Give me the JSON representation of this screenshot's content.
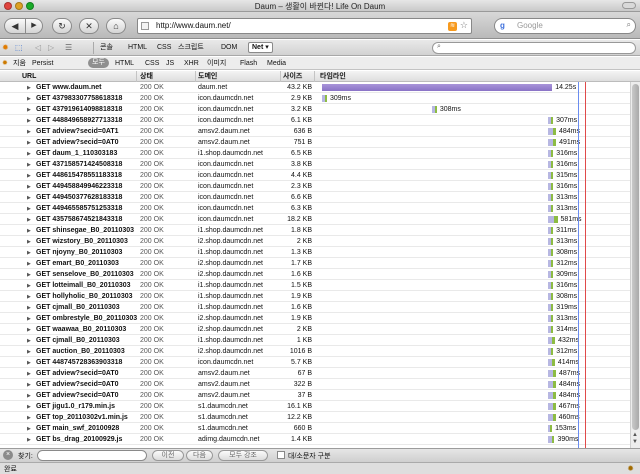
{
  "window": {
    "title": "Daum – 생활이 바뀐다! Life On Daum"
  },
  "nav": {
    "back_icon": "◀",
    "forward_icon": "▶",
    "reload_icon": "↻",
    "stop_icon": "✕",
    "home_icon": "⌂",
    "url": "http://www.daum.net/",
    "rss_icon": "rss",
    "bookmark_icon": "☆",
    "search_engine_icon": "g",
    "search_placeholder": "Google"
  },
  "firebug": {
    "tabs": [
      "콘솔",
      "HTML",
      "CSS",
      "스크립트",
      "DOM",
      "Net ▾"
    ],
    "active_tab": "Net"
  },
  "filters": {
    "clear": "지움",
    "persist": "Persist",
    "items": [
      "모두",
      "HTML",
      "CSS",
      "JS",
      "XHR",
      "이미지",
      "Flash",
      "Media"
    ],
    "active": "모두"
  },
  "columns": {
    "url": "URL",
    "status": "상태",
    "domain": "도메인",
    "size": "사이즈",
    "timeline": "타임라인"
  },
  "requests": [
    {
      "url": "GET www.daum.net",
      "status": "200 OK",
      "domain": "daum.net",
      "size": "43.2 KB",
      "time": "14.25s",
      "start": 0.0,
      "duration": 14.25
    },
    {
      "url": "GET 437983307758618318",
      "status": "200 OK",
      "domain": "icon.daumcdn.net",
      "size": "2.9 KB",
      "time": "309ms",
      "start": 0.0,
      "duration": 0.309
    },
    {
      "url": "GET 437919614098818318",
      "status": "200 OK",
      "domain": "icon.daumcdn.net",
      "size": "3.2 KB",
      "time": "308ms",
      "start": 6.8,
      "duration": 0.308
    },
    {
      "url": "GET 448849658927713318",
      "status": "200 OK",
      "domain": "icon.daumcdn.net",
      "size": "6.1 KB",
      "time": "307ms",
      "start": 14.0,
      "duration": 0.307
    },
    {
      "url": "GET adview?secid=0AT1",
      "status": "200 OK",
      "domain": "amsv2.daum.net",
      "size": "636 B",
      "time": "484ms",
      "start": 14.0,
      "duration": 0.484
    },
    {
      "url": "GET adview?secid=0AT0",
      "status": "200 OK",
      "domain": "amsv2.daum.net",
      "size": "751 B",
      "time": "491ms",
      "start": 14.0,
      "duration": 0.491
    },
    {
      "url": "GET daum_1_110303183",
      "status": "200 OK",
      "domain": "i1.shop.daumcdn.net",
      "size": "6.5 KB",
      "time": "316ms",
      "start": 14.0,
      "duration": 0.316
    },
    {
      "url": "GET 437158571424508318",
      "status": "200 OK",
      "domain": "icon.daumcdn.net",
      "size": "3.8 KB",
      "time": "316ms",
      "start": 14.0,
      "duration": 0.316
    },
    {
      "url": "GET 448615478551183318",
      "status": "200 OK",
      "domain": "icon.daumcdn.net",
      "size": "4.4 KB",
      "time": "315ms",
      "start": 14.0,
      "duration": 0.315
    },
    {
      "url": "GET 449458849946223318",
      "status": "200 OK",
      "domain": "icon.daumcdn.net",
      "size": "2.3 KB",
      "time": "316ms",
      "start": 14.0,
      "duration": 0.316
    },
    {
      "url": "GET 449450377628183318",
      "status": "200 OK",
      "domain": "icon.daumcdn.net",
      "size": "6.6 KB",
      "time": "313ms",
      "start": 14.0,
      "duration": 0.313
    },
    {
      "url": "GET 449465585751253318",
      "status": "200 OK",
      "domain": "icon.daumcdn.net",
      "size": "6.3 KB",
      "time": "313ms",
      "start": 14.0,
      "duration": 0.313
    },
    {
      "url": "GET 435758674521843318",
      "status": "200 OK",
      "domain": "icon.daumcdn.net",
      "size": "18.2 KB",
      "time": "581ms",
      "start": 14.0,
      "duration": 0.581
    },
    {
      "url": "GET shinsegae_B0_20110303",
      "status": "200 OK",
      "domain": "i1.shop.daumcdn.net",
      "size": "1.8 KB",
      "time": "311ms",
      "start": 14.0,
      "duration": 0.311
    },
    {
      "url": "GET wizstory_B0_20110303",
      "status": "200 OK",
      "domain": "i2.shop.daumcdn.net",
      "size": "2 KB",
      "time": "313ms",
      "start": 14.0,
      "duration": 0.313
    },
    {
      "url": "GET njoyny_B0_20110303",
      "status": "200 OK",
      "domain": "i1.shop.daumcdn.net",
      "size": "1.3 KB",
      "time": "308ms",
      "start": 14.0,
      "duration": 0.308
    },
    {
      "url": "GET emart_B0_20110303",
      "status": "200 OK",
      "domain": "i2.shop.daumcdn.net",
      "size": "1.7 KB",
      "time": "312ms",
      "start": 14.0,
      "duration": 0.312
    },
    {
      "url": "GET senselove_B0_20110303",
      "status": "200 OK",
      "domain": "i2.shop.daumcdn.net",
      "size": "1.6 KB",
      "time": "309ms",
      "start": 14.0,
      "duration": 0.309
    },
    {
      "url": "GET lotteimall_B0_20110303",
      "status": "200 OK",
      "domain": "i1.shop.daumcdn.net",
      "size": "1.5 KB",
      "time": "316ms",
      "start": 14.0,
      "duration": 0.316
    },
    {
      "url": "GET hollyholic_B0_20110303",
      "status": "200 OK",
      "domain": "i1.shop.daumcdn.net",
      "size": "1.9 KB",
      "time": "308ms",
      "start": 14.0,
      "duration": 0.308
    },
    {
      "url": "GET cjmall_B0_20110303",
      "status": "200 OK",
      "domain": "i1.shop.daumcdn.net",
      "size": "1.6 KB",
      "time": "319ms",
      "start": 14.0,
      "duration": 0.319
    },
    {
      "url": "GET ombrestyle_B0_20110303",
      "status": "200 OK",
      "domain": "i2.shop.daumcdn.net",
      "size": "1.9 KB",
      "time": "313ms",
      "start": 14.0,
      "duration": 0.313
    },
    {
      "url": "GET waawaa_B0_20110303",
      "status": "200 OK",
      "domain": "i2.shop.daumcdn.net",
      "size": "2 KB",
      "time": "314ms",
      "start": 14.0,
      "duration": 0.314
    },
    {
      "url": "GET cjmall_B0_20110303",
      "status": "200 OK",
      "domain": "i1.shop.daumcdn.net",
      "size": "1 KB",
      "time": "432ms",
      "start": 14.0,
      "duration": 0.432
    },
    {
      "url": "GET auction_B0_20110303",
      "status": "200 OK",
      "domain": "i2.shop.daumcdn.net",
      "size": "1016 B",
      "time": "312ms",
      "start": 14.0,
      "duration": 0.312
    },
    {
      "url": "GET 448745728363903318",
      "status": "200 OK",
      "domain": "icon.daumcdn.net",
      "size": "5.7 KB",
      "time": "414ms",
      "start": 14.0,
      "duration": 0.414
    },
    {
      "url": "GET adview?secid=0AT0",
      "status": "200 OK",
      "domain": "amsv2.daum.net",
      "size": "67 B",
      "time": "487ms",
      "start": 14.0,
      "duration": 0.487
    },
    {
      "url": "GET adview?secid=0AT0",
      "status": "200 OK",
      "domain": "amsv2.daum.net",
      "size": "322 B",
      "time": "484ms",
      "start": 14.0,
      "duration": 0.484
    },
    {
      "url": "GET adview?secid=0AT0",
      "status": "200 OK",
      "domain": "amsv2.daum.net",
      "size": "37 B",
      "time": "484ms",
      "start": 14.0,
      "duration": 0.484
    },
    {
      "url": "GET jigu1.0_r179.min.js",
      "status": "200 OK",
      "domain": "s1.daumcdn.net",
      "size": "16.1 KB",
      "time": "467ms",
      "start": 14.0,
      "duration": 0.467
    },
    {
      "url": "GET top_20110302v1.min.js",
      "status": "200 OK",
      "domain": "s1.daumcdn.net",
      "size": "12.2 KB",
      "time": "460ms",
      "start": 14.0,
      "duration": 0.46
    },
    {
      "url": "GET main_swf_20100928",
      "status": "200 OK",
      "domain": "s1.daumcdn.net",
      "size": "660 B",
      "time": "153ms",
      "start": 14.0,
      "duration": 0.153
    },
    {
      "url": "GET bs_drag_20100929.js",
      "status": "200 OK",
      "domain": "adimg.daumcdn.net",
      "size": "1.4 KB",
      "time": "390ms",
      "start": 14.0,
      "duration": 0.39
    }
  ],
  "findbar": {
    "close_icon": "×",
    "label": "찾기:",
    "value": "",
    "prev": "이전",
    "next": "다음",
    "highlight": "모두 강조",
    "match_case": "대/소문자 구분"
  },
  "statusbar": {
    "text": "완료",
    "icon": "bug"
  }
}
